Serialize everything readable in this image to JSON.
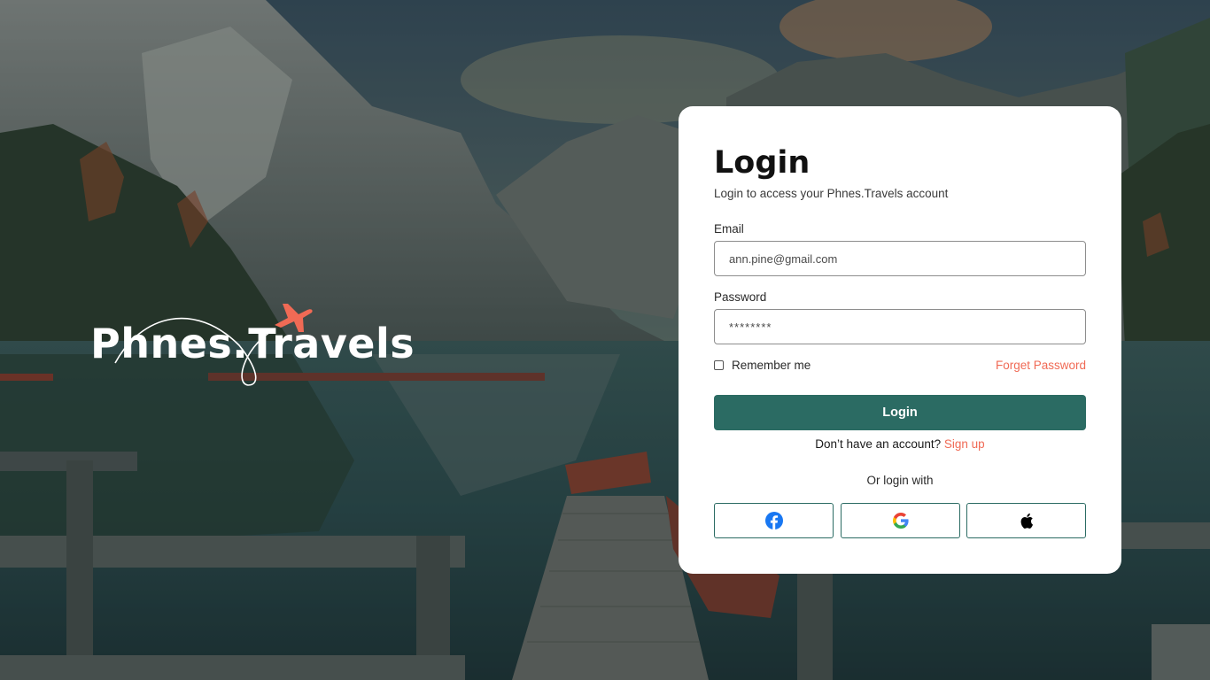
{
  "brand": {
    "name": "Phnes.Travels",
    "plane_color": "#f06a55"
  },
  "login": {
    "title": "Login",
    "subtitle": "Login to access your Phnes.Travels account",
    "email_label": "Email",
    "email_value": "ann.pine@gmail.com",
    "password_label": "Password",
    "password_value": "********",
    "remember_label": "Remember me",
    "remember_checked": false,
    "forgot_label": "Forget Password",
    "button_label": "Login",
    "no_account_text": "Don’t have an account?",
    "signup_label": "Sign up",
    "or_text": "Or login with",
    "social": [
      {
        "name": "facebook",
        "icon": "facebook-icon",
        "color": "#1877f2"
      },
      {
        "name": "google",
        "icon": "google-icon",
        "color": "#4285f4"
      },
      {
        "name": "apple",
        "icon": "apple-icon",
        "color": "#000000"
      }
    ]
  },
  "colors": {
    "primary": "#2b6b63",
    "accent": "#f06a55",
    "card": "#ffffff"
  }
}
